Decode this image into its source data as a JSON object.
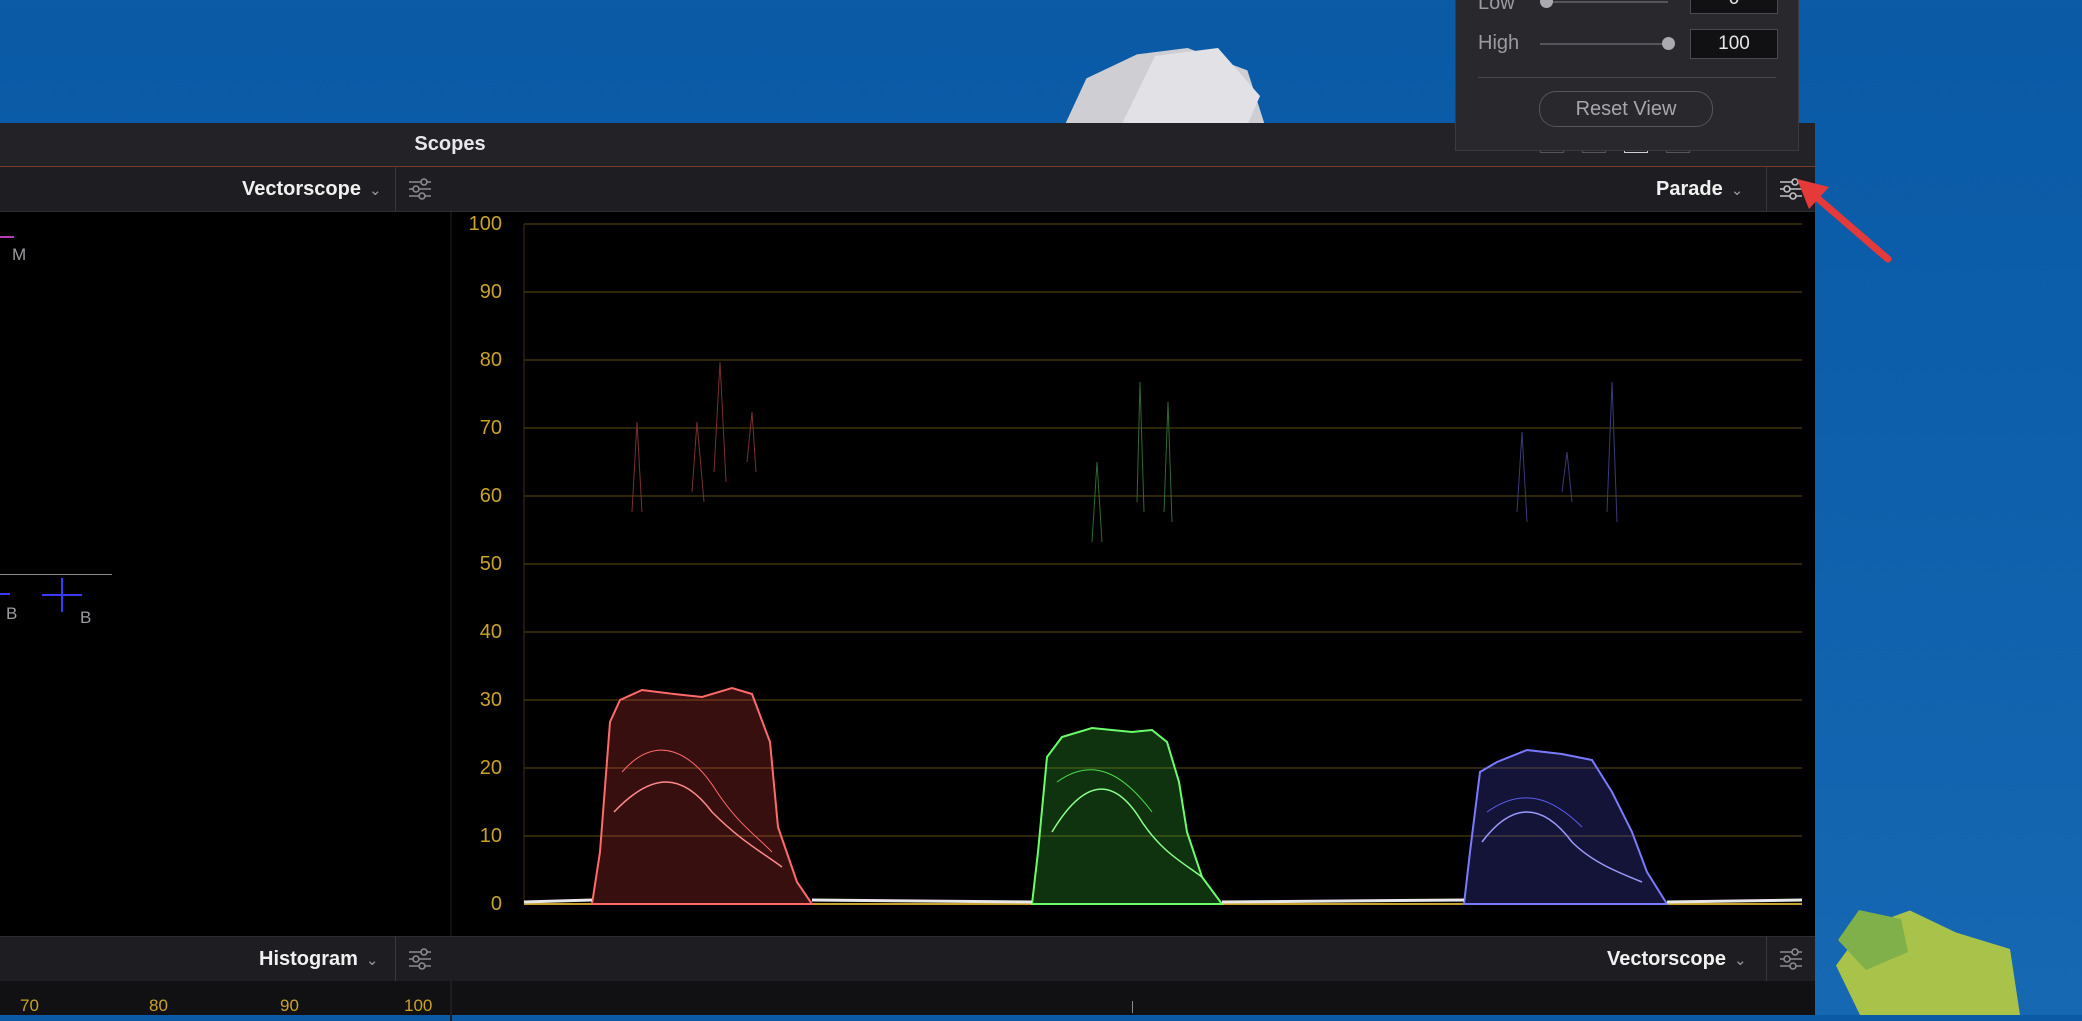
{
  "window": {
    "title": "Scopes"
  },
  "top_left_panel": {
    "scope": "Vectorscope",
    "markers": {
      "m": "M",
      "b1": "B",
      "b2": "B"
    }
  },
  "top_right_panel": {
    "scope": "Parade",
    "y_axis": [
      "100",
      "90",
      "80",
      "70",
      "60",
      "50",
      "40",
      "30",
      "20",
      "10",
      "0"
    ]
  },
  "bottom_left_panel": {
    "scope": "Histogram",
    "x_axis": [
      "70",
      "80",
      "90",
      "100"
    ]
  },
  "bottom_right_panel": {
    "scope": "Vectorscope"
  },
  "settings_popup": {
    "low_label": "Low",
    "low_value": "0",
    "high_label": "High",
    "high_value": "100",
    "reset_label": "Reset View"
  },
  "colors": {
    "accent_axis": "#c9a227",
    "red_channel": "#ff5a5a",
    "green_channel": "#5aff5a",
    "blue_channel": "#6a6aff",
    "pointer_arrow": "#e63a3a"
  },
  "icons": {
    "settings": "sliders-icon",
    "dropdown": "chevron-down-icon"
  }
}
